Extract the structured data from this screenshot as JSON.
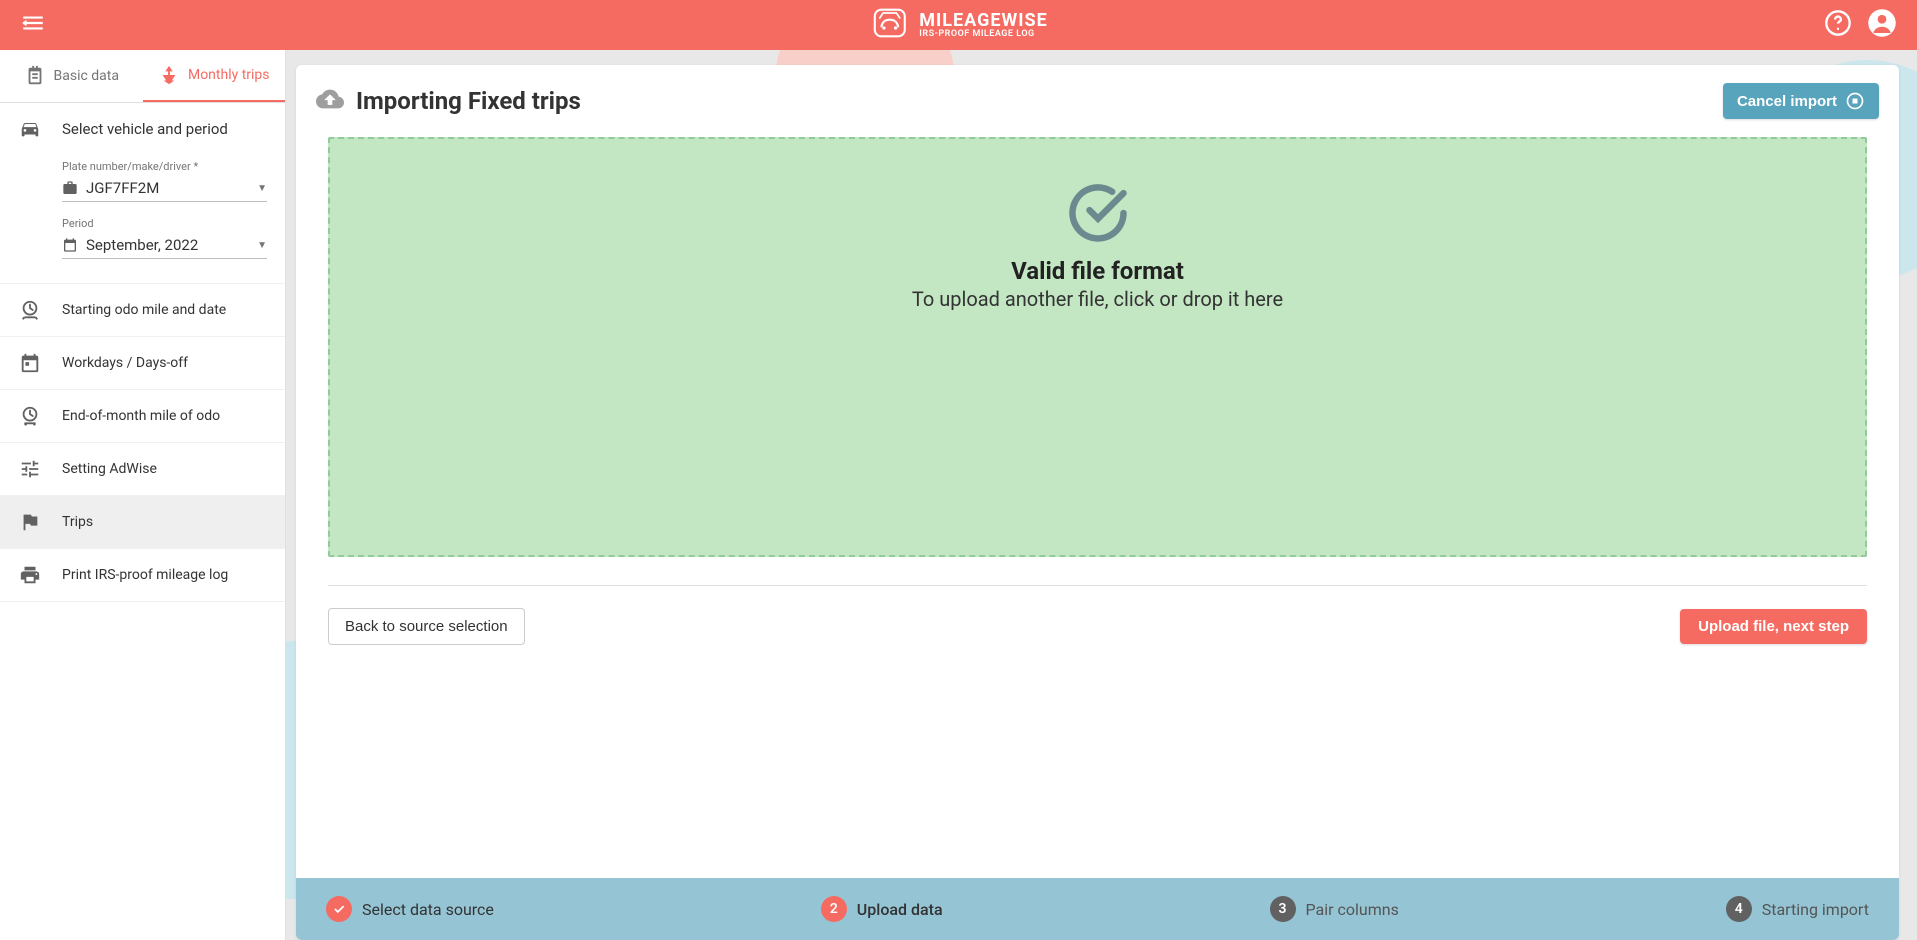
{
  "brand": {
    "name": "MILEAGEWISE",
    "tagline": "IRS-PROOF MILEAGE LOG"
  },
  "tabs": {
    "basic": "Basic data",
    "monthly": "Monthly trips"
  },
  "sidebar": {
    "select_title": "Select vehicle and period",
    "plate_label": "Plate number/make/driver *",
    "plate_value": "JGF7FF2M",
    "period_label": "Period",
    "period_value": "September, 2022",
    "nav": [
      "Starting odo mile and date",
      "Workdays / Days-off",
      "End-of-month mile of odo",
      "Setting AdWise",
      "Trips",
      "Print IRS-proof mileage log"
    ]
  },
  "panel": {
    "title": "Importing Fixed trips",
    "cancel": "Cancel import",
    "dz_title": "Valid file format",
    "dz_sub": "To upload another file, click or drop it here",
    "back": "Back to source selection",
    "next": "Upload file, next step"
  },
  "stepper": {
    "s1": "Select data source",
    "s2": "Upload data",
    "s3": "Pair columns",
    "s4": "Starting import",
    "n2": "2",
    "n3": "3",
    "n4": "4"
  }
}
